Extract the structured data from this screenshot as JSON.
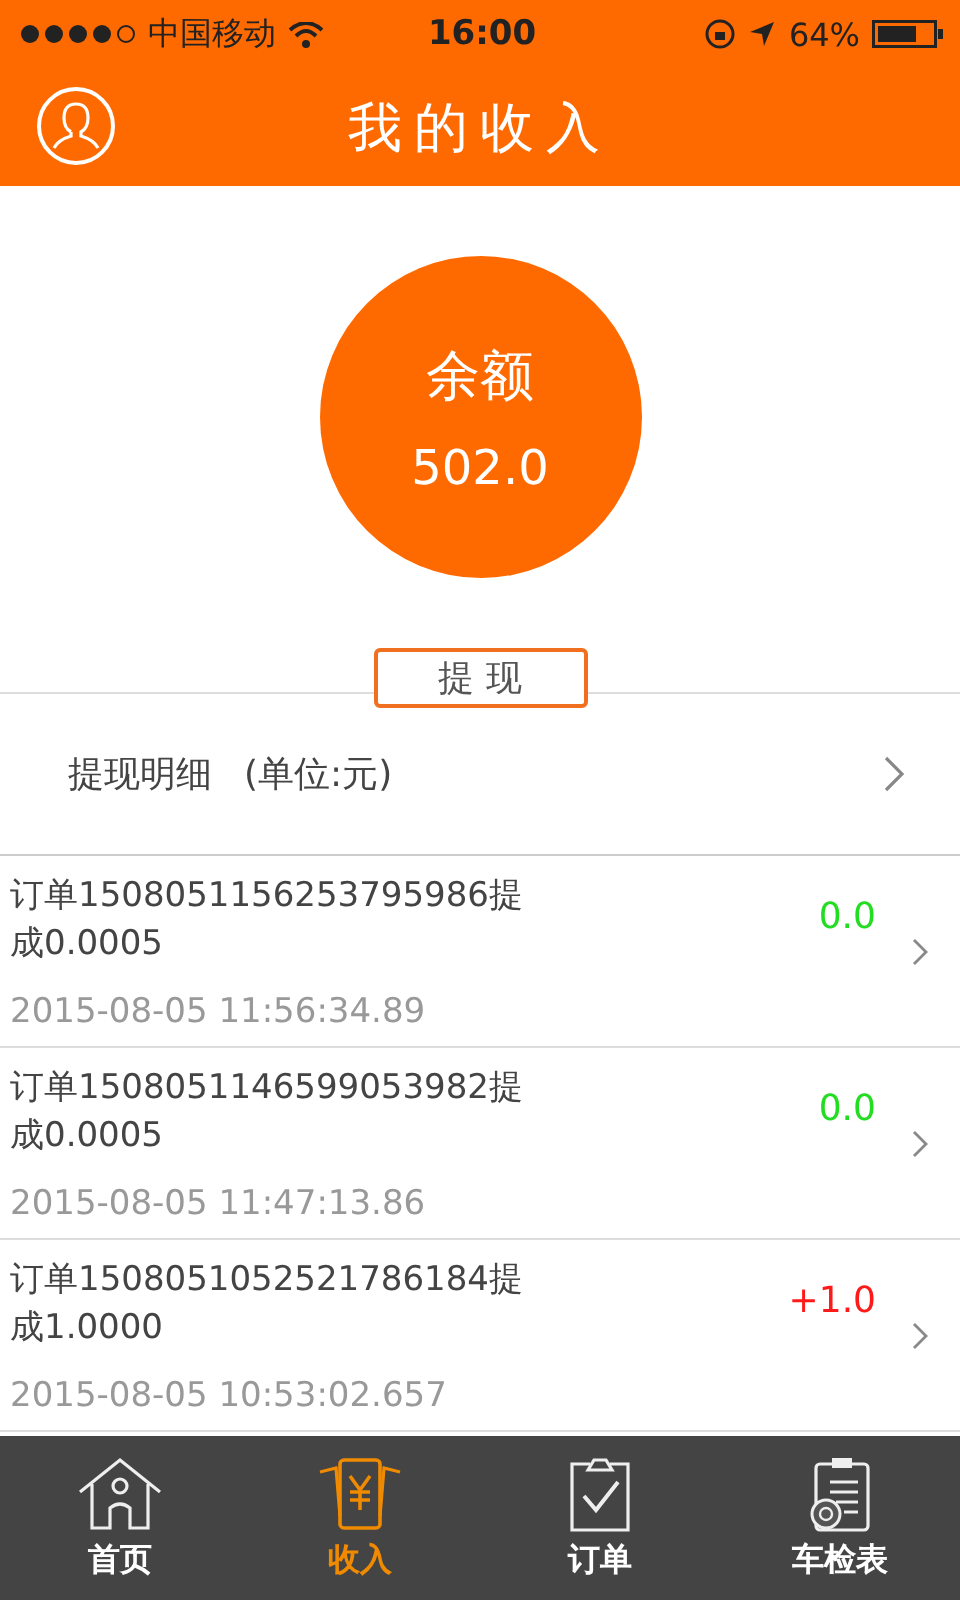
{
  "status_bar": {
    "carrier": "中国移动",
    "time": "16:00",
    "battery": "64%"
  },
  "nav": {
    "title": "我的收入"
  },
  "balance": {
    "label": "余额",
    "amount": "502.0"
  },
  "withdraw_button": "提 现",
  "detail_link": {
    "label": "提现明细",
    "unit": "(单位:元)"
  },
  "records": [
    {
      "title": "订单1508051156253795986提成0.0005",
      "time": "2015-08-05 11:56:34.89",
      "amount": "0.0",
      "color": "#22dd22"
    },
    {
      "title": "订单1508051146599053982提成0.0005",
      "time": "2015-08-05 11:47:13.86",
      "amount": "0.0",
      "color": "#22dd22"
    },
    {
      "title": "订单1508051052521786184提成1.0000",
      "time": "2015-08-05 10:53:02.657",
      "amount": "+1.0",
      "color": "#ff1a1a"
    }
  ],
  "tabs": [
    {
      "label": "首页",
      "kind": "home",
      "selected": false
    },
    {
      "label": "收入",
      "kind": "income",
      "selected": true
    },
    {
      "label": "订单",
      "kind": "orders",
      "selected": false
    },
    {
      "label": "车检表",
      "kind": "inspection",
      "selected": false
    }
  ]
}
